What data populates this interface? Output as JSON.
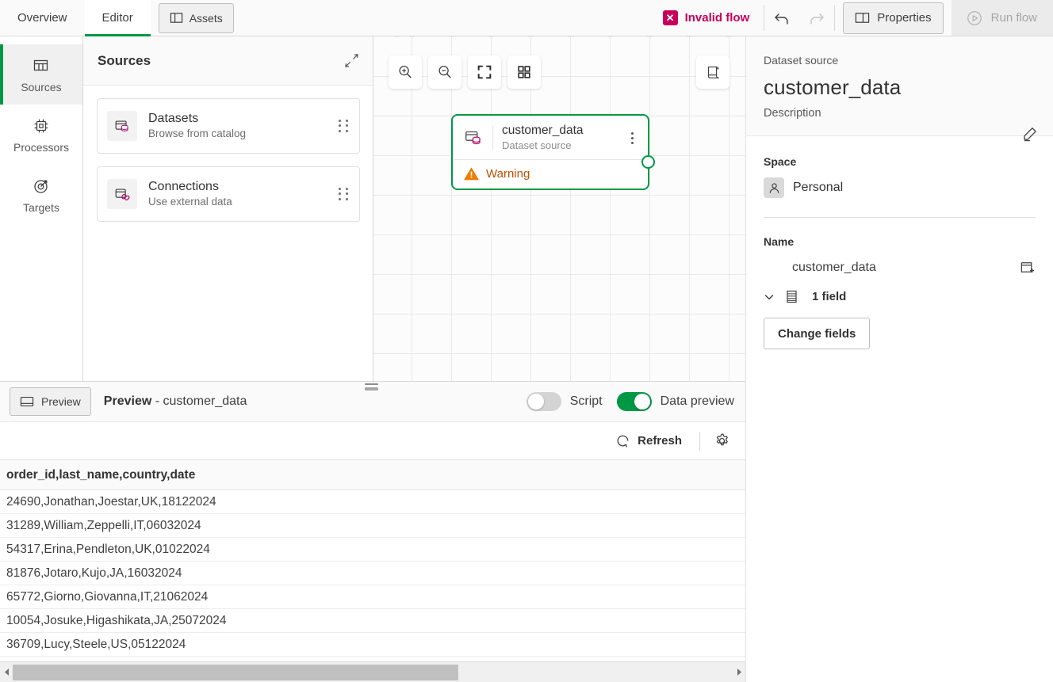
{
  "topbar": {
    "tabs": [
      {
        "label": "Overview",
        "active": false
      },
      {
        "label": "Editor",
        "active": true
      }
    ],
    "assets_label": "Assets",
    "invalid_flow_label": "Invalid flow",
    "invalid_badge_glyph": "✕",
    "properties_label": "Properties",
    "run_flow_label": "Run flow",
    "accent_color": "#009845",
    "error_color": "#c9005a"
  },
  "rail": {
    "items": [
      {
        "label": "Sources",
        "icon": "table-icon",
        "active": true
      },
      {
        "label": "Processors",
        "icon": "chip-icon",
        "active": false
      },
      {
        "label": "Targets",
        "icon": "target-icon",
        "active": false
      }
    ]
  },
  "sources": {
    "title": "Sources",
    "collapse_icon": "collapse-icon",
    "cards": [
      {
        "title": "Datasets",
        "subtitle": "Browse from catalog",
        "icon": "dataset-icon"
      },
      {
        "title": "Connections",
        "subtitle": "Use external data",
        "icon": "connection-icon"
      }
    ]
  },
  "canvas": {
    "tools": [
      {
        "name": "zoom-in-icon"
      },
      {
        "name": "zoom-out-icon"
      },
      {
        "name": "fit-screen-icon"
      },
      {
        "name": "overview-grid-icon"
      }
    ],
    "script_tool": {
      "name": "script-icon"
    },
    "node": {
      "name": "customer_data",
      "subtitle": "Dataset source",
      "status_label": "Warning",
      "status_color": "#bf4f00",
      "border_color": "#009845"
    }
  },
  "properties": {
    "kicker": "Dataset source",
    "title": "customer_data",
    "description": "Description",
    "space_label": "Space",
    "space_value": "Personal",
    "name_label": "Name",
    "name_value": "customer_data",
    "fields_label": "1 field",
    "change_fields_label": "Change fields"
  },
  "preview": {
    "button_label": "Preview",
    "caption_bold": "Preview",
    "caption_rest": " - customer_data",
    "script_toggle": {
      "label": "Script",
      "on": false
    },
    "data_preview_toggle": {
      "label": "Data preview",
      "on": true
    },
    "refresh_label": "Refresh",
    "settings_icon": "gear-icon"
  },
  "table": {
    "header": "order_id,last_name,country,date",
    "rows": [
      "24690,Jonathan,Joestar,UK,18122024",
      "31289,William,Zeppelli,IT,06032024",
      "54317,Erina,Pendleton,UK,01022024",
      "81876,Jotaro,Kujo,JA,16032024",
      "65772,Giorno,Giovanna,IT,21062024",
      "10054,Josuke,Higashikata,JA,25072024",
      "36709,Lucy,Steele,US,05122024"
    ]
  }
}
